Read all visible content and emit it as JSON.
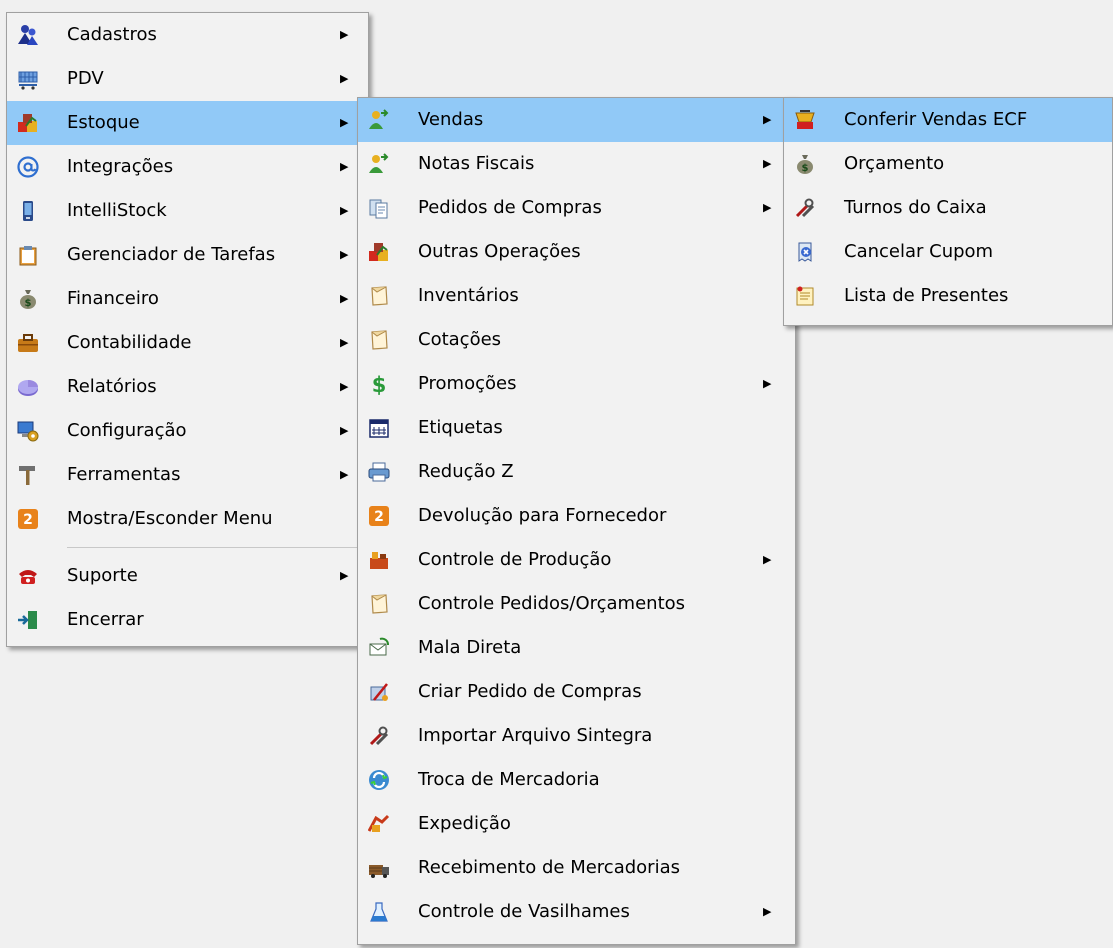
{
  "main_menu": {
    "items": [
      {
        "label": "Cadastros",
        "icon": "users-icon",
        "submenu": true
      },
      {
        "label": "PDV",
        "icon": "cart-icon",
        "submenu": true
      },
      {
        "label": "Estoque",
        "icon": "boxes-icon",
        "submenu": true,
        "selected": true
      },
      {
        "label": "Integrações",
        "icon": "at-icon",
        "submenu": true
      },
      {
        "label": "IntelliStock",
        "icon": "phone-icon",
        "submenu": true
      },
      {
        "label": "Gerenciador de Tarefas",
        "icon": "clipboard-icon",
        "submenu": true
      },
      {
        "label": "Financeiro",
        "icon": "money-bag-icon",
        "submenu": true
      },
      {
        "label": "Contabilidade",
        "icon": "briefcase-icon",
        "submenu": true
      },
      {
        "label": "Relatórios",
        "icon": "pie-chart-icon",
        "submenu": true
      },
      {
        "label": "Configuração",
        "icon": "computer-gear-icon",
        "submenu": true
      },
      {
        "label": "Ferramentas",
        "icon": "hammer-icon",
        "submenu": true
      },
      {
        "label": "Mostra/Esconder Menu",
        "icon": "toggle-menu-icon",
        "submenu": false
      }
    ],
    "bottom_items": [
      {
        "label": "Suporte",
        "icon": "telephone-icon",
        "submenu": true
      },
      {
        "label": "Encerrar",
        "icon": "exit-door-icon",
        "submenu": false
      }
    ]
  },
  "estoque_menu": {
    "items": [
      {
        "label": "Vendas",
        "icon": "user-arrow-icon",
        "submenu": true,
        "selected": true
      },
      {
        "label": "Notas Fiscais",
        "icon": "user-arrow-icon",
        "submenu": true
      },
      {
        "label": "Pedidos de Compras",
        "icon": "documents-icon",
        "submenu": true
      },
      {
        "label": "Outras Operações",
        "icon": "boxes-icon",
        "submenu": false
      },
      {
        "label": "Inventários",
        "icon": "note-icon",
        "submenu": false
      },
      {
        "label": "Cotações",
        "icon": "note-icon",
        "submenu": false
      },
      {
        "label": "Promoções",
        "icon": "dollar-icon",
        "submenu": true
      },
      {
        "label": "Etiquetas",
        "icon": "calendar-icon",
        "submenu": false
      },
      {
        "label": "Redução Z",
        "icon": "printer-icon",
        "submenu": false
      },
      {
        "label": "Devolução para Fornecedor",
        "icon": "return-icon",
        "submenu": false
      },
      {
        "label": "Controle de Produção",
        "icon": "production-icon",
        "submenu": true
      },
      {
        "label": "Controle Pedidos/Orçamentos",
        "icon": "note-icon",
        "submenu": false
      },
      {
        "label": "Mala Direta",
        "icon": "mail-icon",
        "submenu": false
      },
      {
        "label": "Criar Pedido de Compras",
        "icon": "create-order-icon",
        "submenu": false
      },
      {
        "label": "Importar Arquivo Sintegra",
        "icon": "tools-icon",
        "submenu": false
      },
      {
        "label": "Troca de Mercadoria",
        "icon": "exchange-icon",
        "submenu": false
      },
      {
        "label": "Expedição",
        "icon": "shipping-icon",
        "submenu": false
      },
      {
        "label": "Recebimento de Mercadorias",
        "icon": "receiving-icon",
        "submenu": false
      },
      {
        "label": "Controle de Vasilhames",
        "icon": "flask-icon",
        "submenu": true
      }
    ]
  },
  "vendas_menu": {
    "items": [
      {
        "label": "Conferir Vendas ECF",
        "icon": "cash-register-icon",
        "selected": true
      },
      {
        "label": "Orçamento",
        "icon": "money-bag-icon"
      },
      {
        "label": "Turnos do Caixa",
        "icon": "tools-icon"
      },
      {
        "label": "Cancelar Cupom",
        "icon": "cancel-receipt-icon"
      },
      {
        "label": "Lista de Presentes",
        "icon": "gift-list-icon"
      }
    ]
  },
  "arrow_glyph": "▶",
  "colors": {
    "highlight": "#91c9f7",
    "menu_bg": "#f2f2f2",
    "desktop_bg": "#f0f0f0"
  }
}
